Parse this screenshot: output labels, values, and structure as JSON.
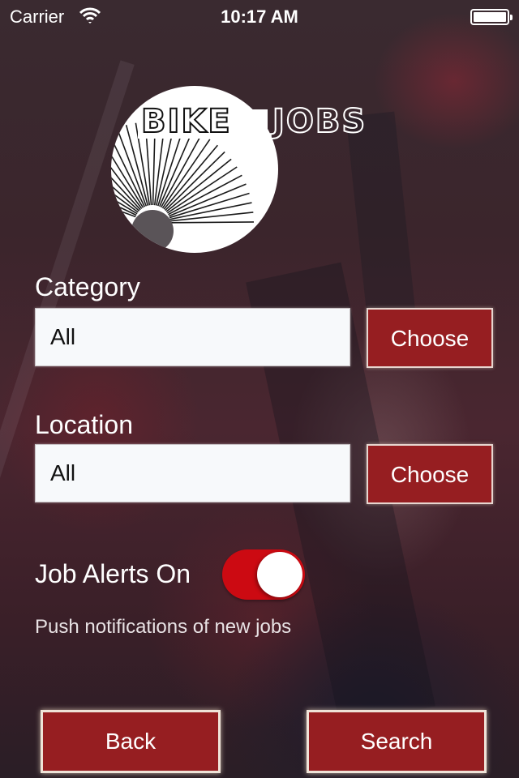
{
  "status_bar": {
    "carrier": "Carrier",
    "time": "10:17 AM",
    "wifi_icon": "wifi-icon",
    "battery_icon": "battery-full-icon"
  },
  "logo": {
    "word1": "BIKE",
    "word2": "JOBS",
    "icon": "bike-wheel-spokes-logo"
  },
  "form": {
    "category": {
      "label": "Category",
      "value": "All",
      "button_label": "Choose"
    },
    "location": {
      "label": "Location",
      "value": "All",
      "button_label": "Choose"
    },
    "alerts": {
      "label": "Job Alerts On",
      "enabled": true,
      "subtitle": "Push notifications of new jobs"
    }
  },
  "buttons": {
    "back": "Back",
    "search": "Search"
  },
  "colors": {
    "accent": "#961e21",
    "toggle_on": "#cc0a12"
  }
}
